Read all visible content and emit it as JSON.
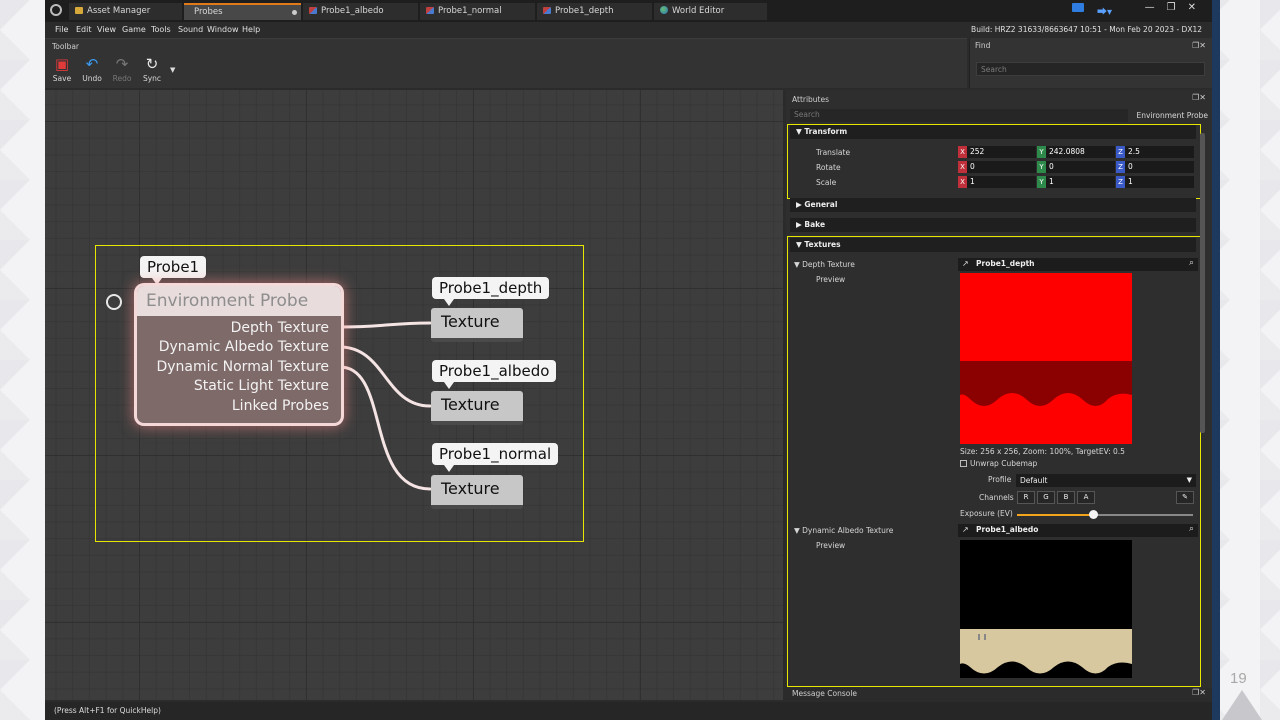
{
  "tabs": [
    {
      "label": "Asset Manager",
      "icon": "folder-icon"
    },
    {
      "label": "Probes",
      "icon": "none",
      "active": true
    },
    {
      "label": "Probe1_albedo",
      "icon": "texture-doc-icon"
    },
    {
      "label": "Probe1_normal",
      "icon": "texture-doc-icon"
    },
    {
      "label": "Probe1_depth",
      "icon": "texture-doc-icon"
    },
    {
      "label": "World Editor",
      "icon": "globe-icon"
    }
  ],
  "menu": [
    "File",
    "Edit",
    "View",
    "Game",
    "Tools",
    "Sound",
    "Window",
    "Help"
  ],
  "build_info": "Build: HRZ2 31633/8663647 10:51 - Mon Feb 20 2023 - DX12",
  "toolbar": {
    "title": "Toolbar",
    "save": "Save",
    "undo": "Undo",
    "redo": "Redo",
    "sync": "Sync"
  },
  "find": {
    "title": "Find",
    "placeholder": "Search"
  },
  "graph": {
    "probe_label": "Probe1",
    "node_title": "Environment Probe",
    "ports": [
      "Depth Texture",
      "Dynamic Albedo Texture",
      "Dynamic Normal Texture",
      "Static Light Texture",
      "Linked Probes"
    ],
    "texture_nodes": [
      {
        "label": "Probe1_depth",
        "node_text": "Texture"
      },
      {
        "label": "Probe1_albedo",
        "node_text": "Texture"
      },
      {
        "label": "Probe1_normal",
        "node_text": "Texture"
      }
    ]
  },
  "attributes": {
    "title": "Attributes",
    "search_placeholder": "Search",
    "object_type": "Environment Probe",
    "transform": {
      "header": "Transform",
      "translate_label": "Translate",
      "rotate_label": "Rotate",
      "scale_label": "Scale",
      "translate": {
        "x": "252",
        "y": "242.0808",
        "z": "2.5"
      },
      "rotate": {
        "x": "0",
        "y": "0",
        "z": "0"
      },
      "scale": {
        "x": "1",
        "y": "1",
        "z": "1"
      }
    },
    "general_header": "General",
    "bake_header": "Bake",
    "textures": {
      "header": "Textures",
      "depth_label": "Depth Texture",
      "depth_value": "Probe1_depth",
      "preview_label": "Preview",
      "size_info": "Size: 256 x 256, Zoom: 100%, TargetEV: 0.5",
      "unwrap_label": "Unwrap Cubemap",
      "profile_label": "Profile",
      "profile_value": "Default",
      "channels_label": "Channels",
      "channels": [
        "R",
        "G",
        "B",
        "A"
      ],
      "exposure_label": "Exposure (EV)",
      "exposure_fraction": 0.43,
      "albedo_label": "Dynamic Albedo Texture",
      "albedo_value": "Probe1_albedo",
      "albedo_preview_label": "Preview"
    }
  },
  "message_console": "Message Console",
  "status_bar": "(Press Alt+F1 for QuickHelp)",
  "slide_number": "19",
  "colors": {
    "accent_tab": "#e07a1a",
    "selection_box": "#e6e600",
    "x_axis": "#c0303a",
    "y_axis": "#2d8a4a",
    "z_axis": "#3a5ac8",
    "slider_fill": "#f2a51c",
    "depth_preview": "#ff0000",
    "depth_wave": "#8b0000",
    "albedo_wave": "#d8c8a0"
  }
}
